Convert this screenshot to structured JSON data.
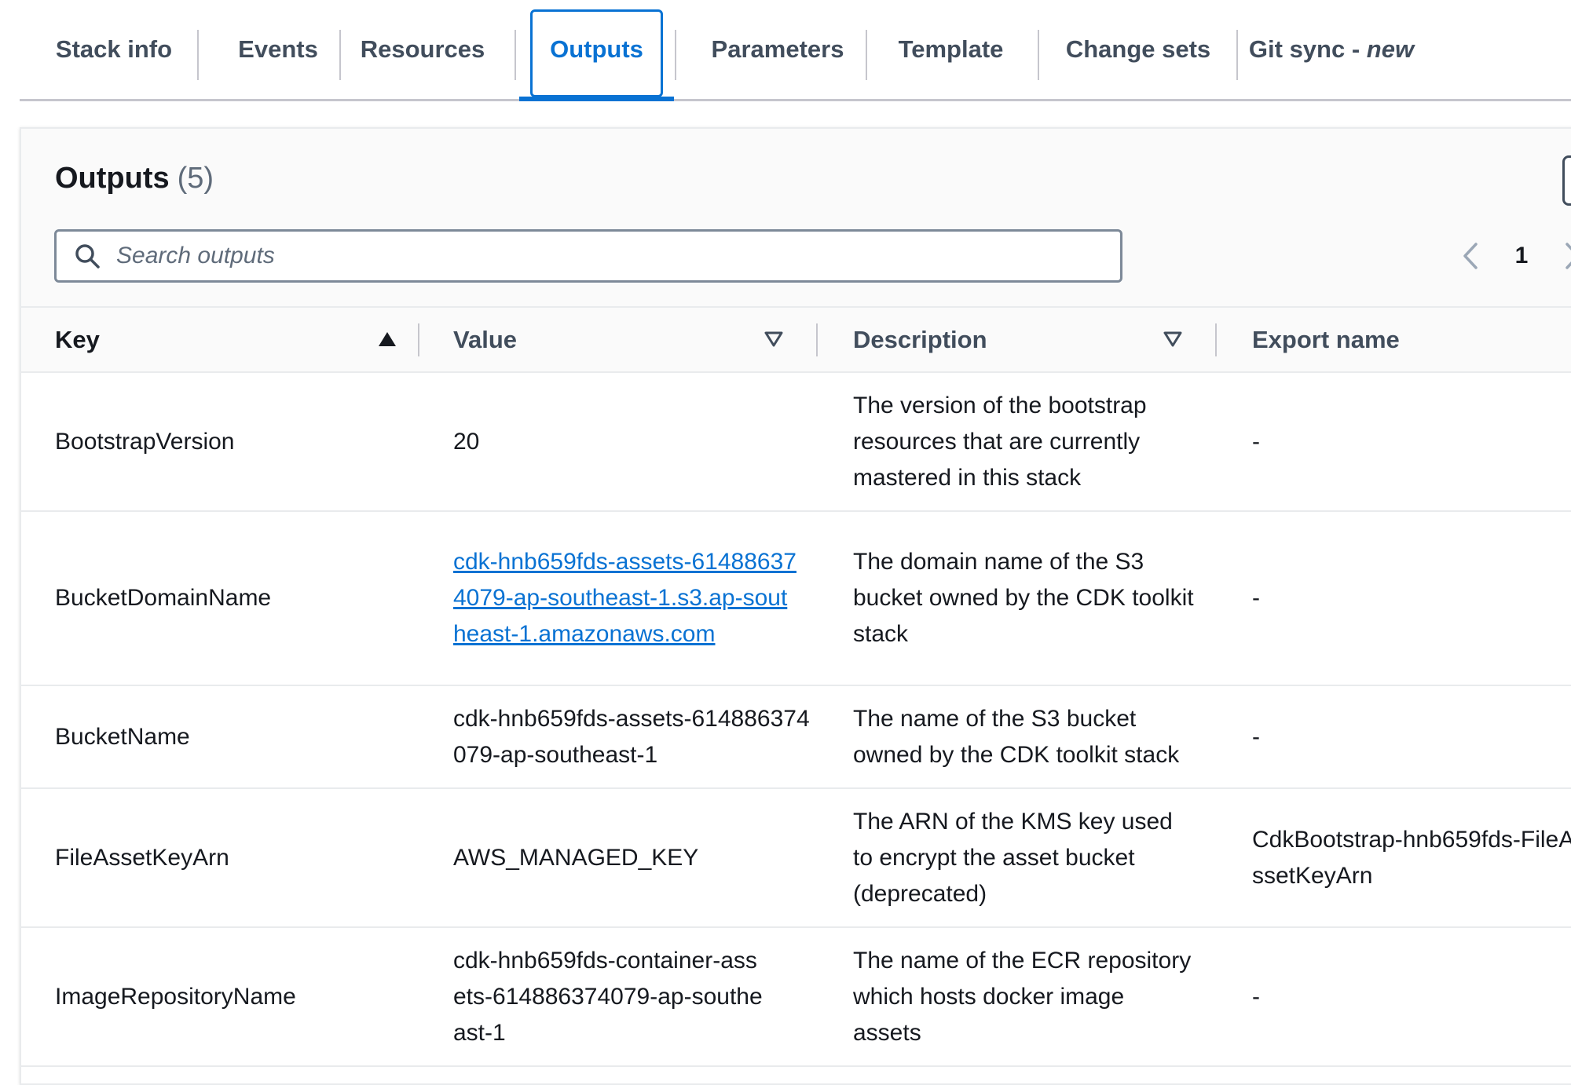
{
  "tabs": [
    {
      "label": "Stack info"
    },
    {
      "label": "Events"
    },
    {
      "label": "Resources"
    },
    {
      "label": "Outputs",
      "active": true
    },
    {
      "label": "Parameters"
    },
    {
      "label": "Template"
    },
    {
      "label": "Change sets"
    },
    {
      "label": "Git sync - ",
      "badge": "new"
    }
  ],
  "outputs": {
    "title": "Outputs",
    "count": "(5)",
    "search_placeholder": "Search outputs",
    "page": "1",
    "columns": {
      "key": "Key",
      "value": "Value",
      "description": "Description",
      "export_name": "Export name"
    },
    "sort": {
      "key": "ascending",
      "value": "none",
      "description": "none"
    },
    "rows": [
      {
        "key": "BootstrapVersion",
        "value": "20",
        "description": "The version of the bootstrap resources that are currently mastered in this stack",
        "export_name": "-"
      },
      {
        "key": "BucketDomainName",
        "value": "cdk-hnb659fds-assets-614886374079-ap-southeast-1.s3.ap-southeast-1.amazonaws.com",
        "value_is_link": true,
        "description": "The domain name of the S3 bucket owned by the CDK toolkit stack",
        "export_name": "-"
      },
      {
        "key": "BucketName",
        "value": "cdk-hnb659fds-assets-614886374079-ap-southeast-1",
        "description": "The name of the S3 bucket owned by the CDK toolkit stack",
        "export_name": "-"
      },
      {
        "key": "FileAssetKeyArn",
        "value": "AWS_MANAGED_KEY",
        "description": "The ARN of the KMS key used to encrypt the asset bucket (deprecated)",
        "export_name": "CdkBootstrap-hnb659fds-FileAssetKeyArn"
      },
      {
        "key": "ImageRepositoryName",
        "value": "cdk-hnb659fds-container-assets-614886374079-ap-southeast-1",
        "description": "The name of the ECR repository which hosts docker image assets",
        "export_name": "-"
      }
    ]
  },
  "colors": {
    "accent": "#0972d3",
    "text": "#16191f",
    "muted": "#414d5c",
    "divider": "#e9ebed"
  }
}
